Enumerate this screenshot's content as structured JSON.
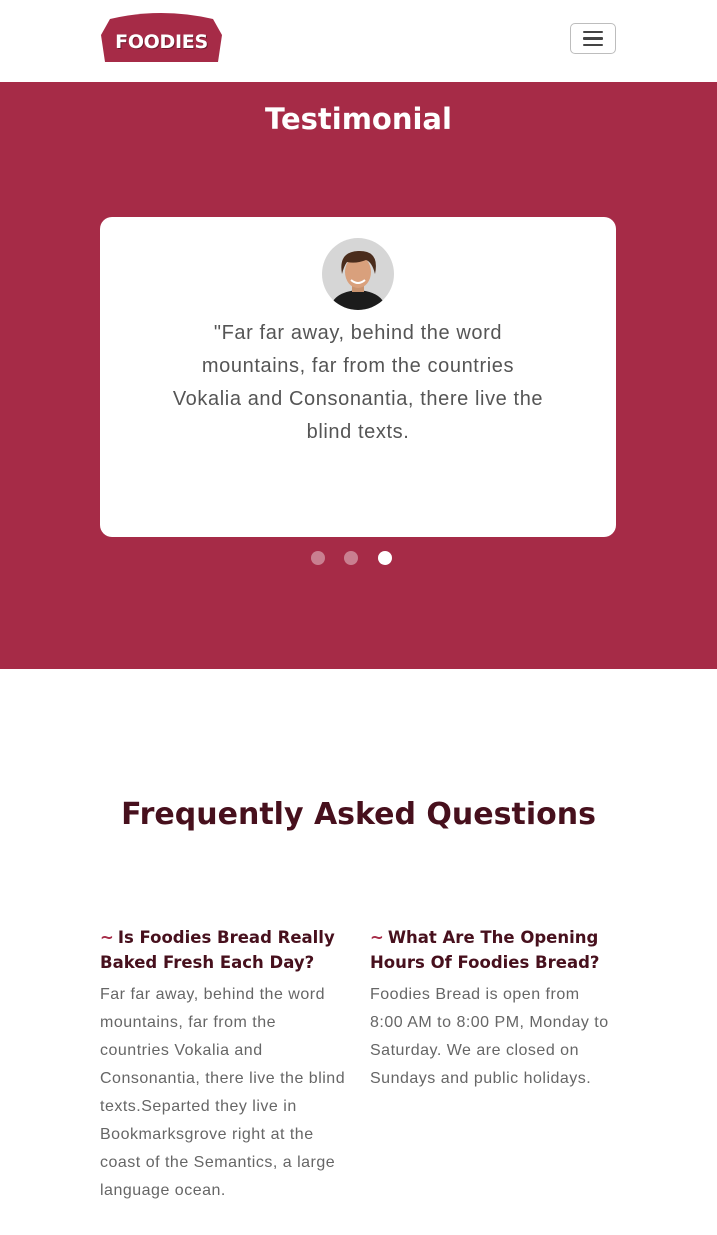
{
  "header": {
    "logo_text": "FOODIES",
    "menu_icon": "hamburger-menu-icon",
    "brand_color": "#a62b47"
  },
  "testimonial": {
    "title": "Testimonial",
    "quote": "\"Far far away, behind the word mountains, far from the countries Vokalia and Consonantia, there live the blind texts.",
    "background_color": "#a62b47",
    "carousel": {
      "slides": 3,
      "active_index": 2
    }
  },
  "faq": {
    "title": "Frequently Asked Questions",
    "items": [
      {
        "marker": "~",
        "question": "Is Foodies Bread Really Baked Fresh Each Day?",
        "answer": "Far far away, behind the word mountains, far from the countries Vokalia and Consonantia, there live the blind texts.Separted they live in Bookmarksgrove right at the coast of the Semantics, a large language ocean."
      },
      {
        "marker": "~",
        "question": "What Are The Opening Hours Of Foodies Bread?",
        "answer": "Foodies Bread is open from 8:00 AM to 8:00 PM, Monday to Saturday. We are closed on Sundays and public holidays."
      }
    ]
  }
}
